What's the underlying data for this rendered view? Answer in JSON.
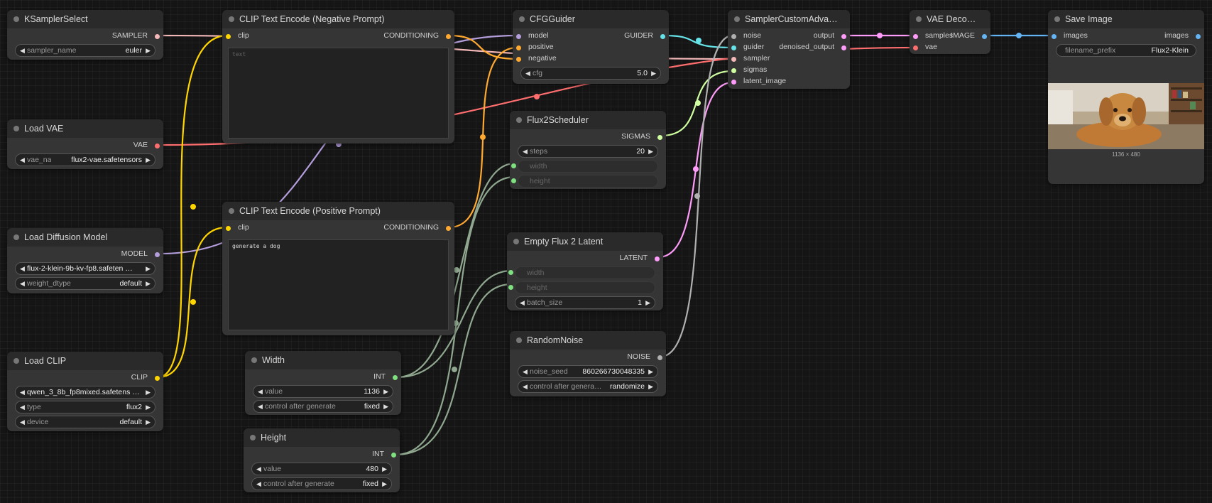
{
  "colors": {
    "sampler": "#f4b8b8",
    "vae": "#ff6e6e",
    "model": "#b39ddb",
    "clip": "#ffd500",
    "conditioning": "#ffa931",
    "guider": "#66e3e8",
    "sigmas": "#cfffa0",
    "latent": "#ff9cf9",
    "noise": "#b0b0b0",
    "image": "#64b5f6",
    "int": "#7fe080",
    "int_link": "#90a890"
  },
  "nodes": {
    "ksampler_select": {
      "title": "KSamplerSelect",
      "output": "SAMPLER",
      "widget_label": "sampler_name",
      "widget_value": "euler"
    },
    "load_vae": {
      "title": "Load VAE",
      "output": "VAE",
      "widget_label": "vae_na",
      "widget_value": "flux2-vae.safetensors"
    },
    "load_diffusion": {
      "title": "Load Diffusion Model",
      "output": "MODEL",
      "unet_value": "flux-2-klein-9b-kv-fp8.safeten …",
      "dtype_label": "weight_dtype",
      "dtype_value": "default"
    },
    "load_clip": {
      "title": "Load CLIP",
      "output": "CLIP",
      "clip_value": "qwen_3_8b_fp8mixed.safetens …",
      "type_label": "type",
      "type_value": "flux2",
      "device_label": "device",
      "device_value": "default"
    },
    "clip_neg": {
      "title": "CLIP Text Encode (Negative Prompt)",
      "input": "clip",
      "output": "CONDITIONING",
      "placeholder": "text"
    },
    "clip_pos": {
      "title": "CLIP Text Encode (Positive Prompt)",
      "input": "clip",
      "output": "CONDITIONING",
      "text": "generate a dog"
    },
    "width": {
      "title": "Width",
      "output": "INT",
      "value_label": "value",
      "value": "1136",
      "cag_label": "control after generate",
      "cag_value": "fixed"
    },
    "height": {
      "title": "Height",
      "output": "INT",
      "value_label": "value",
      "value": "480",
      "cag_label": "control after generate",
      "cag_value": "fixed"
    },
    "cfg_guider": {
      "title": "CFGGuider",
      "inputs": [
        "model",
        "positive",
        "negative"
      ],
      "output": "GUIDER",
      "cfg_label": "cfg",
      "cfg_value": "5.0"
    },
    "flux2_scheduler": {
      "title": "Flux2Scheduler",
      "output": "SIGMAS",
      "steps_label": "steps",
      "steps_value": "20",
      "width_label": "width",
      "height_label": "height"
    },
    "empty_latent": {
      "title": "Empty Flux 2 Latent",
      "output": "LATENT",
      "width_label": "width",
      "height_label": "height",
      "batch_label": "batch_size",
      "batch_value": "1"
    },
    "random_noise": {
      "title": "RandomNoise",
      "output": "NOISE",
      "seed_label": "noise_seed",
      "seed_value": "860266730048335",
      "cag_label": "control after genera…",
      "cag_value": "randomize"
    },
    "sampler_custom": {
      "title": "SamplerCustomAdva…",
      "inputs": [
        "noise",
        "guider",
        "sampler",
        "sigmas",
        "latent_image"
      ],
      "outputs": [
        "output",
        "denoised_output"
      ]
    },
    "vae_decode": {
      "title": "VAE Deco…",
      "inputs": [
        "samples",
        "vae"
      ],
      "output": "IMAGE"
    },
    "save_image": {
      "title": "Save Image",
      "input": "images",
      "output": "images",
      "prefix_label": "filename_prefix",
      "prefix_value": "Flux2-Klein",
      "preview_caption": "1136 × 480"
    }
  }
}
